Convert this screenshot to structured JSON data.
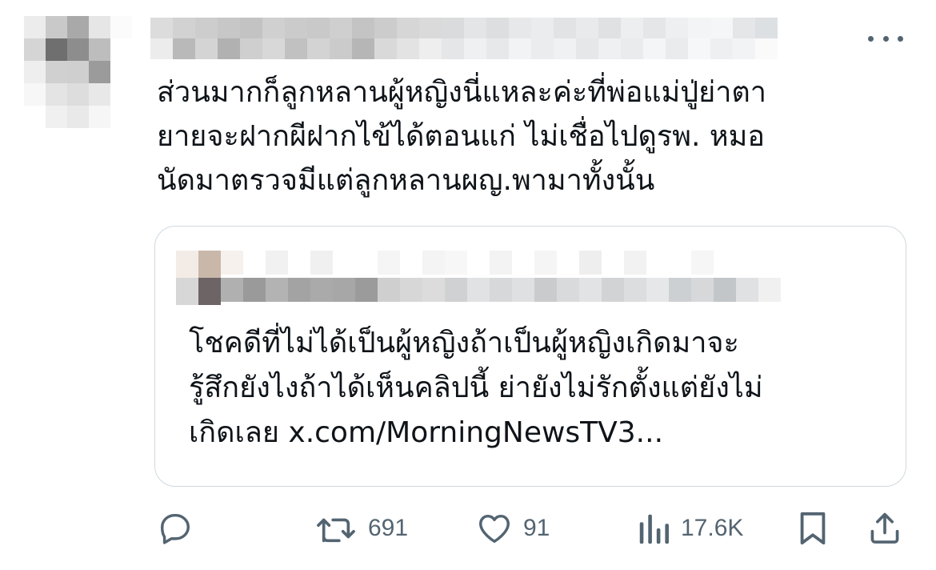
{
  "tweet": {
    "text": "ส่วนมากก็ลูกหลานผู้หญิงนี่แหละค่ะที่พ่อแม่ปู่ย่าตา\nยายจะฝากผีฝากไข้ได้ตอนแก่ ไม่เชื่อไปดูรพ. หมอ\nนัดมาตรวจมีแต่ลูกหลานผญ.พามาทั้งนั้น"
  },
  "quoted_tweet": {
    "text": "โชคดีที่ไม่ได้เป็นผู้หญิงถ้าเป็นผู้หญิงเกิดมาจะ\nรู้สึกยังไงถ้าได้เห็นคลิปนี้ ย่ายังไม่รักตั้งแต่ยังไม่\nเกิดเลย x.com/MorningNewsTV3..."
  },
  "actions": {
    "reply_icon": "speech-bubble-icon",
    "retweet_icon": "retweet-icon",
    "retweets": "691",
    "like_icon": "heart-icon",
    "likes": "91",
    "views_icon": "bar-chart-icon",
    "views": "17.6K",
    "bookmark_icon": "bookmark-icon",
    "share_icon": "share-icon"
  },
  "colors": {
    "text": "#0f1419",
    "muted": "#536471",
    "border": "#cfd9de"
  }
}
